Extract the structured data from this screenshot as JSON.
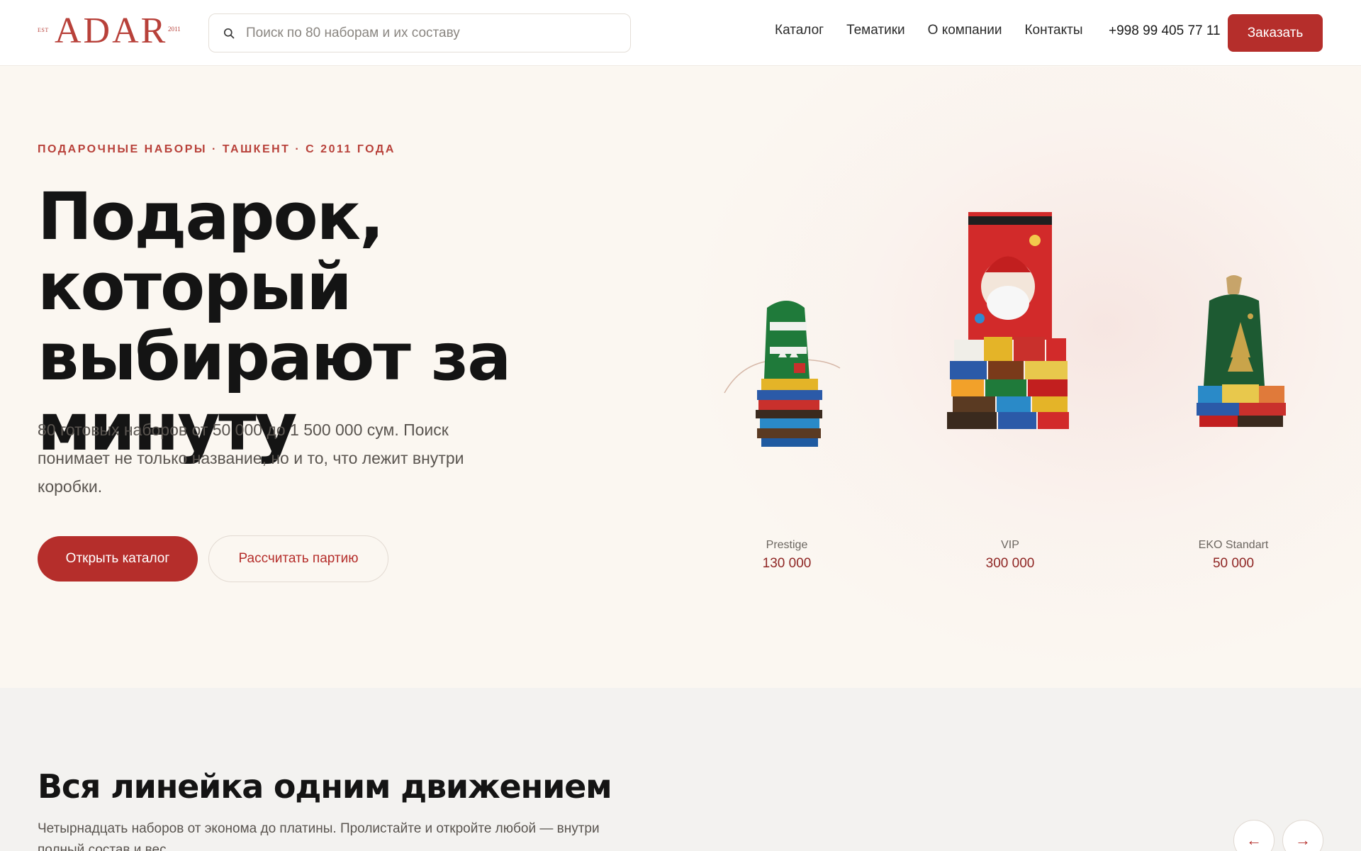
{
  "brand": {
    "est": "EST",
    "name": "ADAR",
    "year": "2011",
    "color": "#b8413a"
  },
  "search": {
    "placeholder": "Поиск по 80 наборам и их составу",
    "value": ""
  },
  "nav": {
    "items": [
      "Каталог",
      "Тематики",
      "О компании",
      "Контакты"
    ],
    "phone": "+998 99 405 77 11",
    "order_label": "Заказать"
  },
  "hero": {
    "eyebrow": "ПОДАРОЧНЫЕ НАБОРЫ · ТАШКЕНТ · С 2011 ГОДА",
    "title_line1": "Подарок, который",
    "title_line2": "выбирают за",
    "title_line3": "минуту",
    "subtitle": "80 готовых наборов от 50 000 до 1 500 000 сум. Поиск понимает не только название, но и то, что лежит внутри коробки.",
    "primary_cta": "Открыть каталог",
    "secondary_cta": "Рассчитать партию",
    "accent_color": "#b52e2b"
  },
  "products": [
    {
      "name": "Prestige",
      "price": "130 000",
      "icon": "knit-bag-gift-icon"
    },
    {
      "name": "VIP",
      "price": "300 000",
      "icon": "santa-box-gift-icon"
    },
    {
      "name": "EKO Standart",
      "price": "50 000",
      "icon": "green-sack-gift-icon"
    }
  ],
  "lineup": {
    "title": "Вся линейка одним движением",
    "subtitle": "Четырнадцать наборов от эконома до платины. Пролистайте и откройте любой — внутри полный состав и вес.",
    "prev_icon": "arrow-left-icon",
    "next_icon": "arrow-right-icon",
    "prev_label": "←",
    "next_label": "→"
  }
}
